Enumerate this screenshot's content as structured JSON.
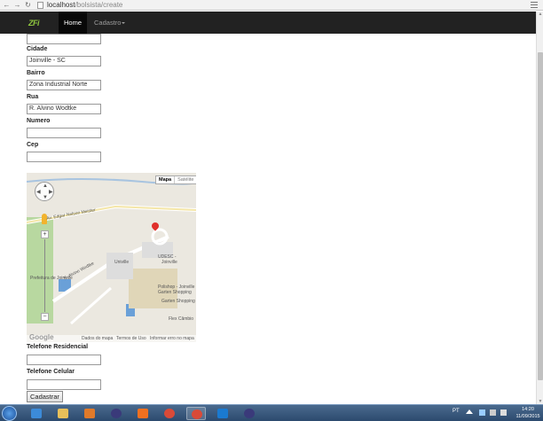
{
  "browser": {
    "url_host": "localhost",
    "url_path": "/bolsista/create"
  },
  "navbar": {
    "brand": "ZFi",
    "home_label": "Home",
    "cadastro_label": "Cadastro"
  },
  "form": {
    "fields": [
      {
        "label": "",
        "value": ""
      },
      {
        "label": "Cidade",
        "value": "Joinville - SC"
      },
      {
        "label": "Bairro",
        "value": "Zona Industrial Norte"
      },
      {
        "label": "Rua",
        "value": "R. Alvino Wodtke"
      },
      {
        "label": "Numero",
        "value": ""
      },
      {
        "label": "Cep",
        "value": ""
      }
    ],
    "after_map_fields": [
      {
        "label": "Telefone Residencial",
        "value": ""
      },
      {
        "label": "Telefone Celular",
        "value": ""
      }
    ],
    "submit_label": "Cadastrar"
  },
  "map": {
    "type_map": "Mapa",
    "type_satellite": "Satélite",
    "labels": {
      "road_top": "Av. Edgar Nelson Meister",
      "road_left": "R. Alvino Wodtke",
      "road_small": "Prefeitura de Joinville",
      "univille": "Univille",
      "udesc_1": "UDESC -",
      "udesc_2": "Joinville",
      "polo_1": "Polishop - Joinville",
      "polo_2": "Garten Shopping",
      "garten": "Garten Shopping",
      "flex": "Flex Câmbio"
    },
    "footer": {
      "google": "Google",
      "dados": "Dados do mapa",
      "termos": "Termos de Uso",
      "erro": "Informar erro no mapa"
    }
  },
  "taskbar": {
    "lang": "PT",
    "time": "14:20",
    "date": "11/09/2015"
  }
}
